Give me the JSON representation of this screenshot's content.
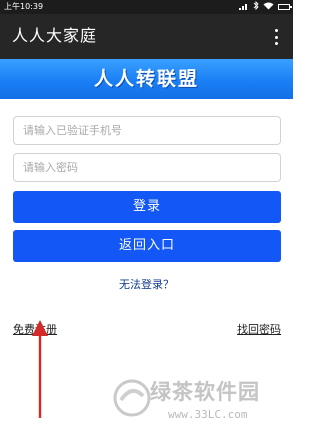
{
  "status_bar": {
    "time": "上午10:39",
    "icons": [
      "signal-icon",
      "bluetooth-icon",
      "wifi-icon",
      "battery-icon"
    ]
  },
  "app_bar": {
    "title": "人人大家庭",
    "menu_icon": "more-vert-icon"
  },
  "banner": {
    "title": "人人转联盟"
  },
  "form": {
    "phone_placeholder": "请输入已验证手机号",
    "password_placeholder": "请输入密码",
    "login_label": "登录",
    "back_label": "返回入口",
    "cannot_login": "无法登录？"
  },
  "footer": {
    "register": "免费注册",
    "recover_password": "找回密码"
  },
  "watermark": {
    "text": "绿茶软件园",
    "url": "www.33LC.com"
  },
  "colors": {
    "button": "#1358f6",
    "banner": "#1a7ff5",
    "app_bar": "#262626",
    "arrow": "#d42a2a"
  }
}
